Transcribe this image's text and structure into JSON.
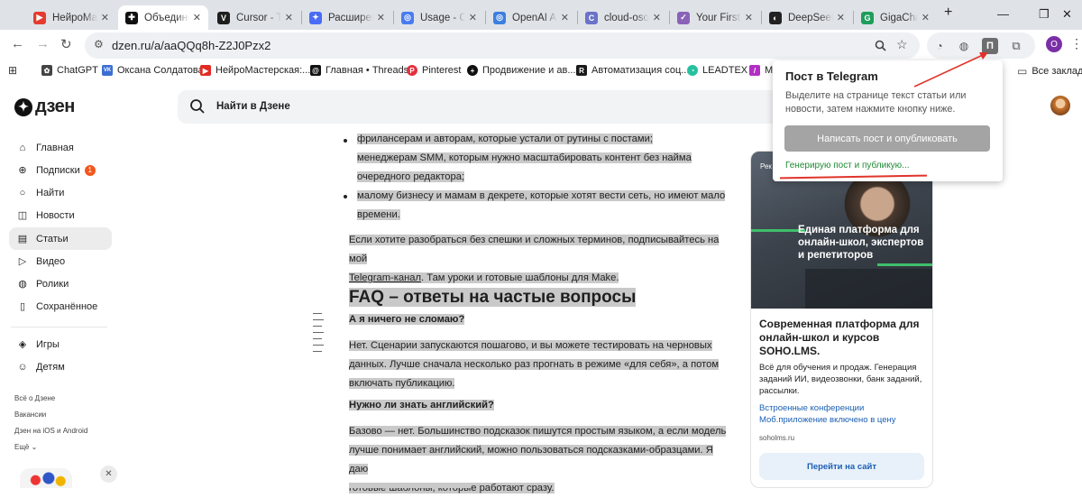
{
  "browser": {
    "tabs": [
      {
        "label": "НейроМаст",
        "color": "#e43c2f",
        "glyph": "▶"
      },
      {
        "label": "Объедине",
        "color": "#111111",
        "glyph": "+",
        "active": true
      },
      {
        "label": "Cursor - Th",
        "color": "#1e1e1e",
        "glyph": "V"
      },
      {
        "label": "Расширени",
        "color": "#4a6cf7",
        "glyph": "✦"
      },
      {
        "label": "Usage - Op",
        "color": "#4a7cf0",
        "glyph": "◎"
      },
      {
        "label": "OpenAI API",
        "color": "#3d7fe0",
        "glyph": "◎"
      },
      {
        "label": "cloud-osoh",
        "color": "#6a72c9",
        "glyph": "C"
      },
      {
        "label": "Your First A",
        "color": "#8a63b8",
        "glyph": "✓"
      },
      {
        "label": "DeepSeek",
        "color": "#222222",
        "glyph": "◐"
      },
      {
        "label": "GigaChat A",
        "color": "#1e9e5b",
        "glyph": "G"
      }
    ],
    "new_tab": "+",
    "url": "dzen.ru/a/aaQQq8h-Z2J0Pzx2",
    "profile_initial": "O"
  },
  "bookmarks": [
    {
      "label": "ChatGPT",
      "color": "#444444",
      "glyph": "✿"
    },
    {
      "label": "Оксана Солдатова",
      "color": "#3b6fd1",
      "glyph": "VK"
    },
    {
      "label": "НейроМастерская:...",
      "color": "#e22b24",
      "glyph": "▶"
    },
    {
      "label": "Главная • Threads",
      "color": "#111111",
      "glyph": "@"
    },
    {
      "label": "Pinterest",
      "color": "#e3323f",
      "glyph": "P"
    },
    {
      "label": "Продвижение и ав...",
      "color": "#111111",
      "glyph": "+"
    },
    {
      "label": "Автоматизация соц...",
      "color": "#1a1a1a",
      "glyph": "R"
    },
    {
      "label": "LEADTEX",
      "color": "#25c0a0",
      "glyph": "◔"
    },
    {
      "label": "M",
      "color": "#b22fc4",
      "glyph": "/"
    }
  ],
  "bookmarks_all": "Все закладки",
  "dzen": {
    "logo": "дзен",
    "search_placeholder": "Найти в Дзене",
    "nav": [
      {
        "label": "Главная",
        "icon": "⌂"
      },
      {
        "label": "Подписки",
        "icon": "⊕",
        "badge": "1"
      },
      {
        "label": "Найти",
        "icon": "○"
      },
      {
        "label": "Новости",
        "icon": "◫"
      },
      {
        "label": "Статьи",
        "icon": "▤",
        "active": true
      },
      {
        "label": "Видео",
        "icon": "▷"
      },
      {
        "label": "Ролики",
        "icon": "◍"
      },
      {
        "label": "Сохранённое",
        "icon": "▯"
      },
      {
        "label": "Игры",
        "icon": "◈"
      },
      {
        "label": "Детям",
        "icon": "☺"
      }
    ],
    "footer_links": [
      "Всё о Дзене",
      "Вакансии",
      "Дзен на iOS и Android",
      "Ещё"
    ]
  },
  "article": {
    "bullet1_line1": "фрилансерам и авторам, которые устали от рутины с постами;",
    "bullet1_line2": "менеджерам SMM, которым нужно масштабировать контент без найма",
    "bullet1_line3": "очередного редактора;",
    "bullet2_line1": "малому бизнесу и мамам в декрете, которые хотят вести сеть, но имеют мало",
    "bullet2_line2": "времени.",
    "subscribe_line1": "Если хотите разобраться без спешки и сложных терминов, подписывайтесь на мой",
    "subscribe_link": "Telegram-канал",
    "subscribe_tail": ". Там уроки и готовые шаблоны для Make.",
    "faq_title": "FAQ – ответы на частые вопросы",
    "q1": "А я ничего не сломаю?",
    "a1_line1": "Нет. Сценарии запускаются пошагово, и вы можете тестировать на черновых",
    "a1_line2": "данных. Лучше сначала несколько раз прогнать в режиме «для себя», а потом",
    "a1_line3": "включать публикацию.",
    "q2": "Нужно ли знать английский?",
    "a2_line1": "Базово — нет. Большинство подсказок пишутся простым языком, а если модель",
    "a2_line2": "лучше понимает английский, можно пользоваться подсказками-образцами. Я даю",
    "a2_line3": "готовые шаблоны, которые работают сразу."
  },
  "ad": {
    "photo_label": "Рек",
    "photo_text": "Единая платформа для онлайн-школ, экспертов и репетиторов",
    "title": "Современная платформа для онлайн-школ и курсов SOHO.LMS.",
    "description": "Всё для обучения и продаж. Генерация заданий ИИ, видеозвонки, банк заданий, рассылки.",
    "links": "Встроенные конференции Моб.приложение включено в цену",
    "domain": "soholms.ru",
    "button": "Перейти на сайт"
  },
  "popup": {
    "title": "Пост в Telegram",
    "description": "Выделите на странице текст статьи или новости, затем нажмите кнопку ниже.",
    "button": "Написать пост и опубликовать",
    "status": "Генерирую пост и публикую..."
  },
  "colors": {
    "accent_red": "#e0342b",
    "status_green": "#1f8a35",
    "link_blue": "#1a5fb4",
    "selection_gray": "#c9c9c9"
  }
}
